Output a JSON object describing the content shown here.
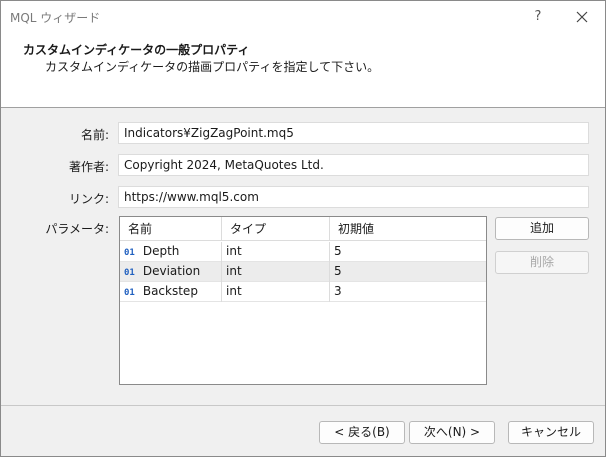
{
  "window": {
    "title": "MQL ウィザード",
    "help_glyph": "?"
  },
  "header": {
    "title": "カスタムインディケータの一般プロパティ",
    "subtitle": "カスタムインディケータの描画プロパティを指定して下さい。"
  },
  "fields": {
    "name_label": "名前:",
    "name_value": "Indicators¥ZigZagPoint.mq5",
    "author_label": "著作者:",
    "author_value": "Copyright 2024, MetaQuotes Ltd.",
    "link_label": "リンク:",
    "link_value": "https://www.mql5.com",
    "params_label": "パラメータ:"
  },
  "params_table": {
    "headers": [
      "名前",
      "タイプ",
      "初期値"
    ],
    "rows": [
      {
        "icon": "01",
        "name": "Depth",
        "type": "int",
        "value": "5"
      },
      {
        "icon": "01",
        "name": "Deviation",
        "type": "int",
        "value": "5"
      },
      {
        "icon": "01",
        "name": "Backstep",
        "type": "int",
        "value": "3"
      }
    ],
    "selected_row": 1
  },
  "side_buttons": {
    "add_label": "追加",
    "delete_label": "削除"
  },
  "footer": {
    "back_label": "< 戻る(B)",
    "next_label": "次へ(N) >",
    "cancel_label": "キャンセル"
  }
}
